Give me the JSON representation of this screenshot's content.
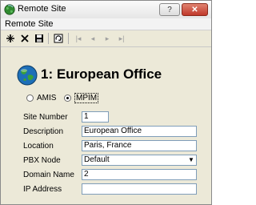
{
  "window": {
    "title": "Remote Site",
    "help_label": "?",
    "close_label": "✕"
  },
  "menubar": {
    "title": "Remote Site"
  },
  "toolbar": {
    "icons": [
      "add-icon",
      "delete-icon",
      "save-icon",
      "refresh-icon",
      "first-record-icon",
      "previous-record-icon",
      "next-record-icon",
      "last-record-icon"
    ]
  },
  "record": {
    "heading": "1: European Office"
  },
  "protocol": {
    "options": [
      {
        "label": "AMIS",
        "selected": false
      },
      {
        "label": "MPIM",
        "selected": true
      }
    ]
  },
  "form": {
    "site_number": {
      "label": "Site Number",
      "value": "1"
    },
    "description": {
      "label": "Description",
      "value": "European Office"
    },
    "location": {
      "label": "Location",
      "value": "Paris, France"
    },
    "pbx_node": {
      "label": "PBX Node",
      "value": "Default"
    },
    "domain_name": {
      "label": "Domain Name",
      "value": "2"
    },
    "ip_address": {
      "label": "IP Address",
      "value": ""
    }
  }
}
